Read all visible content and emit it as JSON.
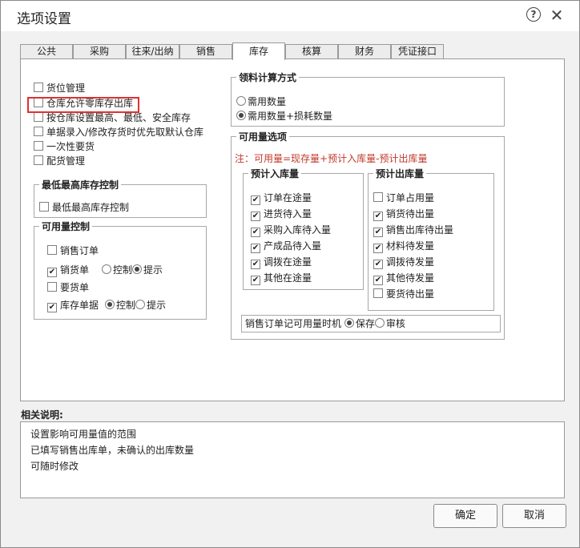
{
  "dialog": {
    "title": "选项设置"
  },
  "tabs": [
    {
      "label": "公共",
      "active": false
    },
    {
      "label": "采购",
      "active": false
    },
    {
      "label": "往来/出纳",
      "active": false
    },
    {
      "label": "销售",
      "active": false
    },
    {
      "label": "库存",
      "active": true
    },
    {
      "label": "核算",
      "active": false
    },
    {
      "label": "财务",
      "active": false
    },
    {
      "label": "凭证接口",
      "active": false
    }
  ],
  "left_options": [
    {
      "label": "货位管理",
      "checked": false
    },
    {
      "label": "仓库允许零库存出库",
      "checked": false
    },
    {
      "label": "按仓库设置最高、最低、安全库存",
      "checked": false
    },
    {
      "label": "单据录入/修改存货时优先取默认仓库",
      "checked": false
    },
    {
      "label": "一次性要货",
      "checked": false
    },
    {
      "label": "配货管理",
      "checked": false
    }
  ],
  "stock_limit_group": {
    "title": "最低最高库存控制",
    "option": {
      "label": "最低最高库存控制",
      "checked": false
    }
  },
  "available_control": {
    "title": "可用量控制",
    "rows": [
      {
        "label": "销售订单",
        "checked": false
      },
      {
        "label": "销货单",
        "checked": true,
        "radio_control": "控制",
        "radio_prompt": "提示",
        "selected": "提示"
      },
      {
        "label": "要货单",
        "checked": false
      },
      {
        "label": "库存单据",
        "checked": true,
        "radio_control": "控制",
        "radio_prompt": "提示",
        "selected": "控制"
      }
    ]
  },
  "material_calc": {
    "title": "领料计算方式",
    "options": [
      {
        "label": "需用数量",
        "selected": false
      },
      {
        "label": "需用数量+损耗数量",
        "selected": true
      }
    ]
  },
  "available_options": {
    "title": "可用量选项",
    "note": "注：可用量=现存量+预计入库量-预计出库量",
    "inbound": {
      "title": "预计入库量",
      "items": [
        {
          "label": "订单在途量",
          "checked": true
        },
        {
          "label": "进货待入量",
          "checked": true
        },
        {
          "label": "采购入库待入量",
          "checked": true
        },
        {
          "label": "产成品待入量",
          "checked": true
        },
        {
          "label": "调拨在途量",
          "checked": true
        },
        {
          "label": "其他在途量",
          "checked": true
        }
      ]
    },
    "outbound": {
      "title": "预计出库量",
      "items": [
        {
          "label": "订单占用量",
          "checked": false
        },
        {
          "label": "销货待出量",
          "checked": true
        },
        {
          "label": "销售出库待出量",
          "checked": true
        },
        {
          "label": "材料待发量",
          "checked": true
        },
        {
          "label": "调拨待发量",
          "checked": true
        },
        {
          "label": "其他待发量",
          "checked": true
        },
        {
          "label": "要货待出量",
          "checked": false
        }
      ]
    },
    "timing": {
      "label": "销售订单记可用量时机",
      "save": "保存",
      "audit": "审核",
      "selected": "保存"
    }
  },
  "related": {
    "title": "相关说明:",
    "lines": [
      "设置影响可用量值的范围",
      "已填写销售出库单，未确认的出库数量",
      "可随时修改"
    ]
  },
  "buttons": {
    "ok": "确定",
    "cancel": "取消"
  }
}
